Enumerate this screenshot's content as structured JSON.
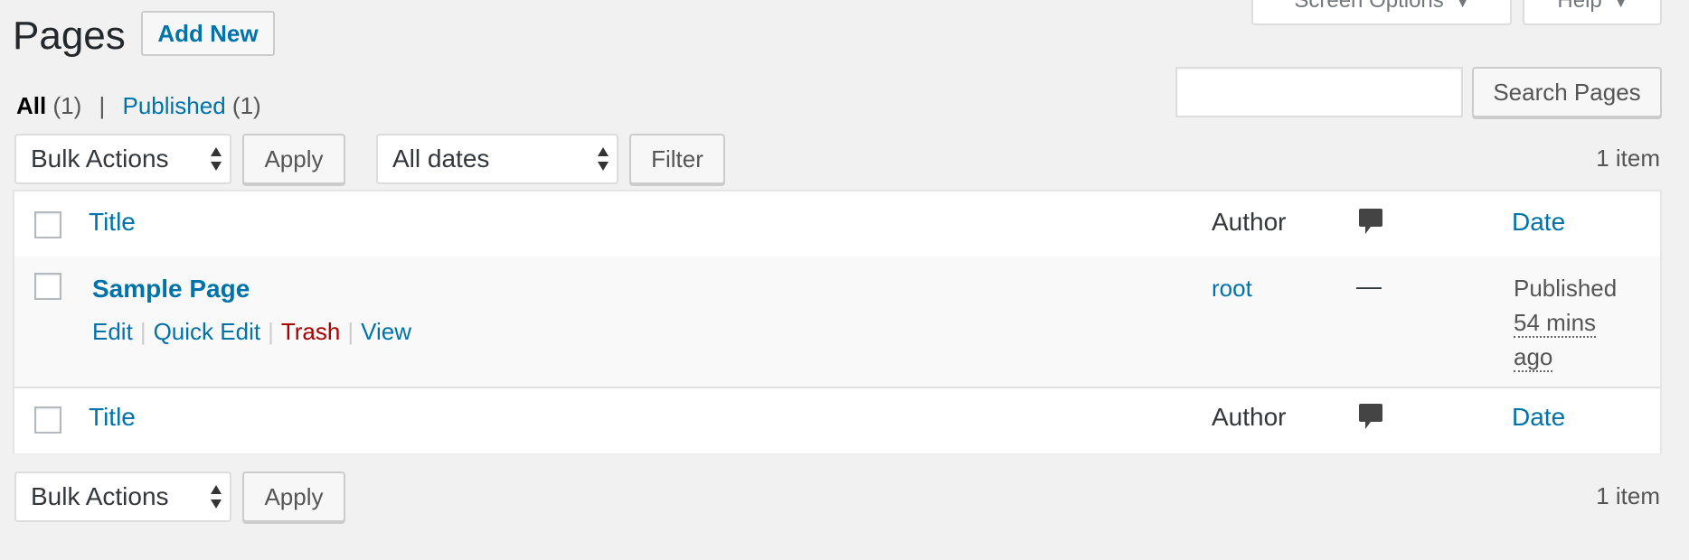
{
  "header": {
    "title": "Pages",
    "add_new_label": "Add New",
    "screen_options_label": "Screen Options",
    "help_label": "Help"
  },
  "views": {
    "all_label": "All",
    "all_count": "(1)",
    "separator": "|",
    "published_label": "Published",
    "published_count": "(1)"
  },
  "search": {
    "value": "",
    "button_label": "Search Pages"
  },
  "tablenav_top": {
    "bulk_actions_label": "Bulk Actions",
    "apply_label": "Apply",
    "dates_label": "All dates",
    "filter_label": "Filter",
    "item_count": "1 item"
  },
  "table": {
    "columns": {
      "title": "Title",
      "author": "Author",
      "comments_icon": "comment-bubble-icon",
      "date": "Date"
    },
    "rows": [
      {
        "title": "Sample Page",
        "actions": {
          "edit": "Edit",
          "quick_edit": "Quick Edit",
          "trash": "Trash",
          "view": "View"
        },
        "author": "root",
        "comments": "—",
        "date_status": "Published",
        "date_relative": "54 mins ago"
      }
    ]
  },
  "tablenav_bottom": {
    "bulk_actions_label": "Bulk Actions",
    "apply_label": "Apply",
    "item_count": "1 item"
  },
  "colors": {
    "link": "#0073aa",
    "trash": "#a00",
    "background": "#f1f1f1"
  }
}
